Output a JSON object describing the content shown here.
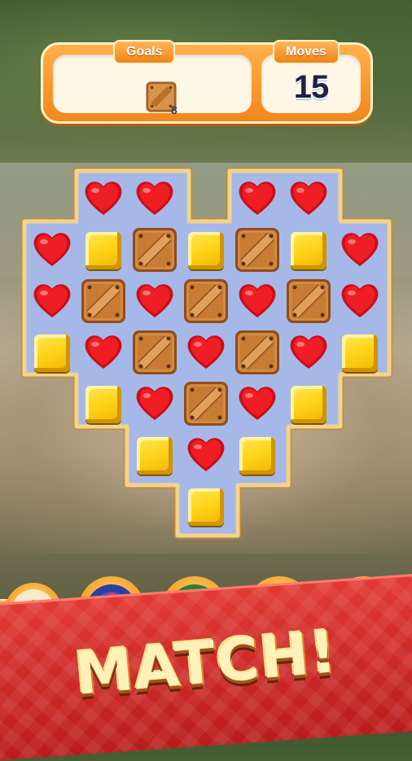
{
  "hud": {
    "goals_label": "Goals",
    "goal_item": "crate-icon",
    "goal_count": "8",
    "moves_label": "Moves",
    "moves_value": "15"
  },
  "board": {
    "rows": [
      [
        null,
        "heart",
        "heart",
        null,
        "heart",
        "heart",
        null
      ],
      [
        "heart",
        "cube",
        "crate",
        "cube",
        "crate",
        "cube",
        "heart"
      ],
      [
        "heart",
        "crate",
        "heart",
        "crate",
        "heart",
        "crate",
        "heart"
      ],
      [
        "cube",
        "heart",
        "crate",
        "heart",
        "crate",
        "heart",
        "cube"
      ],
      [
        null,
        "cube",
        "heart",
        "crate",
        "heart",
        "cube",
        null
      ],
      [
        null,
        null,
        "cube",
        "heart",
        "cube",
        null,
        null
      ],
      [
        null,
        null,
        null,
        "cube",
        null,
        null,
        null
      ]
    ]
  },
  "boosters": [
    {
      "name": "settings",
      "icon": "gear-icon"
    },
    {
      "name": "bomb-booster",
      "icon": "bomb-icon"
    },
    {
      "name": "cannon-booster",
      "icon": "cannon-icon"
    },
    {
      "name": "puzzle-booster",
      "icon": "puzzle-piece-icon"
    },
    {
      "name": "target-booster",
      "icon": "target-icon"
    }
  ],
  "banner": {
    "text": "MATCH!"
  },
  "colors": {
    "heart": "#e8141c",
    "cube": "#ffd51b",
    "crate": "#c9843d",
    "board": "#a6b8e8",
    "banner": "#d42a27"
  }
}
